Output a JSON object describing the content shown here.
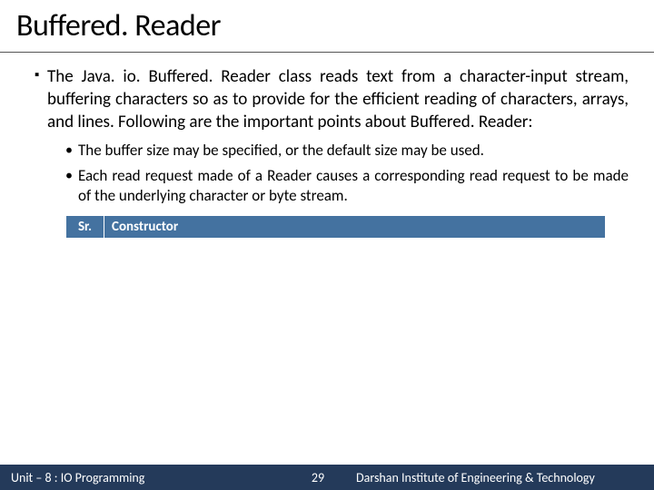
{
  "title": "Buffered. Reader",
  "main_bullet": "The Java. io. Buffered. Reader class reads text from a character-input stream, buffering characters so as to provide for the efficient reading of characters, arrays, and lines. Following are the important points about Buffered. Reader:",
  "sub_bullets": [
    "The buffer size may be specified, or the default size may be used.",
    "Each read request made of a Reader causes a corresponding read request to be made of the underlying character or byte stream."
  ],
  "table": {
    "headers": {
      "sr": "Sr.",
      "ctor": "Constructor"
    }
  },
  "footer": {
    "left": "Unit – 8 : IO Programming",
    "page": "29",
    "right": "Darshan Institute of Engineering & Technology"
  }
}
